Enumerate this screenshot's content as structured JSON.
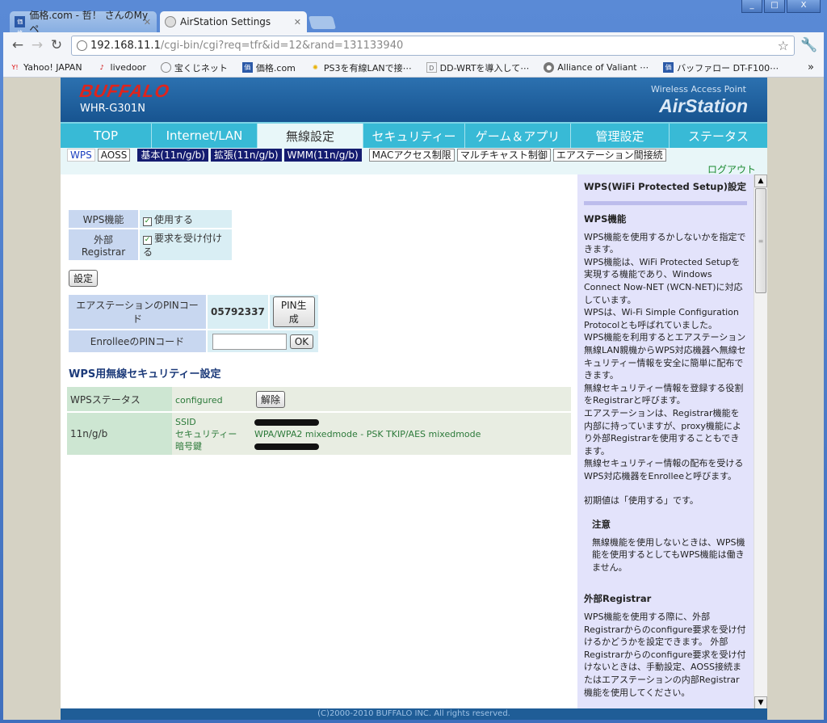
{
  "browser": {
    "tabs": [
      {
        "label": "価格.com - 哲！ さんのMyペ",
        "favicon": "kakaku-icon"
      },
      {
        "label": "AirStation Settings",
        "favicon": "globe-icon"
      }
    ],
    "url_host": "192.168.11.1",
    "url_path": "/cgi-bin/cgi?req=tfr&id=12&rand=131133940",
    "bookmarks": [
      "Yahoo! JAPAN",
      "livedoor",
      "宝くじネット",
      "価格.com",
      "PS3を有線LANで接⋯",
      "DD-WRTを導入して⋯",
      "Alliance of Valiant ⋯",
      "バッファロー DT-F100⋯"
    ],
    "more": "»"
  },
  "header": {
    "brand": "BUFFALO",
    "model": "WHR-G301N",
    "subtitle": "Wireless Access Point",
    "product": "AirStation"
  },
  "nav": {
    "items": [
      "TOP",
      "Internet/LAN",
      "無線設定",
      "セキュリティー",
      "ゲーム＆アプリ",
      "管理設定",
      "ステータス"
    ],
    "active": 2
  },
  "subnav": {
    "items": [
      "WPS",
      "AOSS",
      "基本(11n/g/b)",
      "拡張(11n/g/b)",
      "WMM(11n/g/b)",
      "MACアクセス制限",
      "マルチキャスト制御",
      "エアステーション間接続"
    ],
    "logout": "ログアウト"
  },
  "form": {
    "wps_label": "WPS機能",
    "wps_check": "使用する",
    "registrar_label": "外部Registrar",
    "registrar_check": "要求を受け付ける",
    "set_button": "設定",
    "pin_label": "エアステーションのPINコード",
    "pin_value": "05792337",
    "pin_button": "PIN生成",
    "enrollee_label": "EnrolleeのPINコード",
    "enrollee_value": "",
    "ok_button": "OK"
  },
  "security": {
    "title": "WPS用無線セキュリティー設定",
    "status_label": "WPSステータス",
    "status_value": "configured",
    "release_button": "解除",
    "band": "11n/g/b",
    "ssid_label": "SSID",
    "security_label": "セキュリティー",
    "security_value": "WPA/WPA2 mixedmode - PSK TKIP/AES mixedmode",
    "key_label": "暗号鍵"
  },
  "help": {
    "title": "WPS(WiFi Protected Setup)設定",
    "h1": "WPS機能",
    "p1": "WPS機能を使用するかしないかを指定できます。",
    "p2": "WPS機能は、WiFi Protected Setupを実現する機能であり、Windows Connect Now-NET (WCN-NET)に対応しています。",
    "p3": "WPSは、Wi-Fi Simple Configuration Protocolとも呼ばれていました。",
    "p4": "WPS機能を利用するとエアステーション無線LAN親機からWPS対応機器へ無線セキュリティー情報を安全に簡単に配布できます。",
    "p5": "無線セキュリティー情報を登録する役割をRegistrarと呼びます。",
    "p6": "エアステーションは、Registrar機能を内部に持っていますが、proxy機能により外部Registrarを使用することもできます。",
    "p7": "無線セキュリティー情報の配布を受けるWPS対応機器をEnrolleeと呼びます。",
    "p8": "初期値は「使用する」です。",
    "note_title": "注意",
    "note": "無線機能を使用しないときは、WPS機能を使用するとしてもWPS機能は働きません。",
    "h2": "外部Registrar",
    "p9": "WPS機能を使用する際に、外部Registrarからのconfigure要求を受け付けるかどうかを設定できます。 外部Registrarからのconfigure要求を受け付けないときは、手動設定、AOSS接続またはエアステーションの内部Registrar機能を使用してください。"
  },
  "footer": "(C)2000-2010 BUFFALO INC. All rights reserved."
}
